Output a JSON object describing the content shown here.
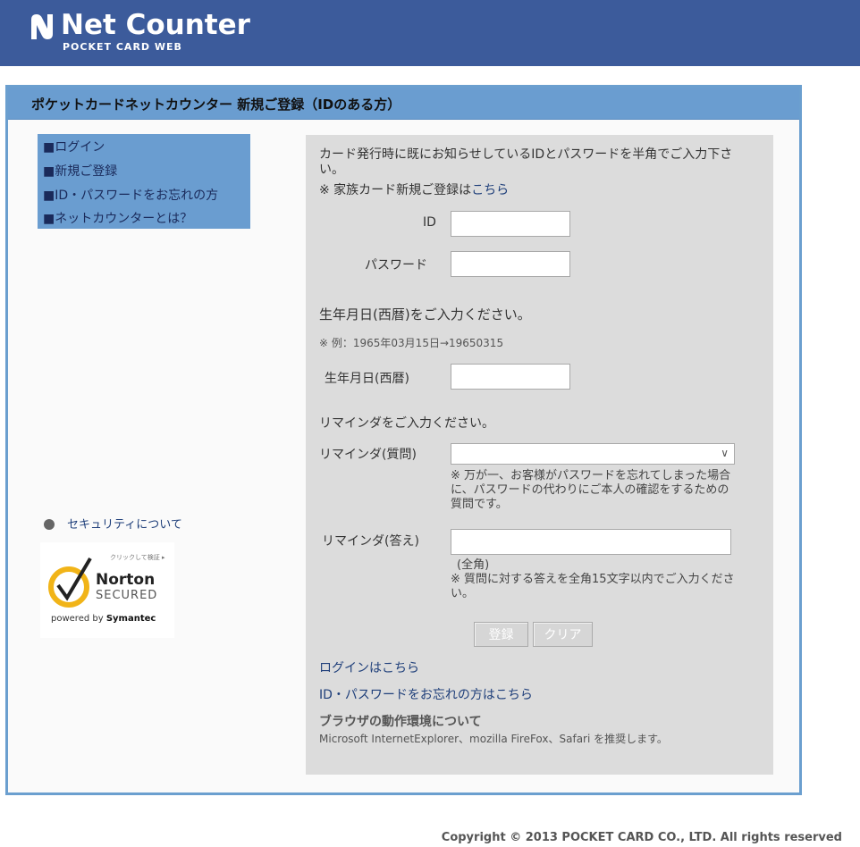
{
  "header": {
    "logo_text": "Net Counter",
    "logo_subtitle": "POCKET CARD WEB"
  },
  "page": {
    "title": "ポケットカードネットカウンター 新規ご登録（IDのある方）"
  },
  "menu": {
    "items": [
      {
        "label": "■ログイン"
      },
      {
        "label": "■新規ご登録"
      },
      {
        "label": "■ID・パスワードをお忘れの方"
      },
      {
        "label": "■ネットカウンターとは？"
      }
    ]
  },
  "security": {
    "link": "セキュリティについて",
    "norton": {
      "click_text": "クリックして検証 ▸",
      "brand": "Norton",
      "secured": "SECURED",
      "powered_prefix": "powered by",
      "powered_by": "Symantec"
    }
  },
  "form": {
    "intro": "カード発行時に既にお知らせしているIDとパスワードを半角でご入力下さい。",
    "family_note_prefix": "※ 家族カード新規ご登録は",
    "family_note_link": "こちら",
    "id_label": "ID",
    "id_value": "",
    "password_label": "パスワード",
    "password_value": "",
    "birth_heading": "生年月日(西暦)をご入力ください。",
    "birth_example": "※ 例：1965年03月15日→19650315",
    "birth_label": "生年月日(西暦)",
    "birth_value": "",
    "reminder_heading": "リマインダをご入力ください。",
    "reminder_question_label": "リマインダ(質問)",
    "reminder_question_selected": "",
    "reminder_question_note": "※ 万が一、お客様がパスワードを忘れてしまった場合に、パスワードの代わりにご本人の確認をするための質問です。",
    "reminder_answer_label": "リマインダ(答え)",
    "reminder_answer_value": "",
    "reminder_answer_hint": "(全角)",
    "reminder_answer_note": "※ 質問に対する答えを全角15文字以内でご入力ください。",
    "register_button": "登録",
    "clear_button": "クリア",
    "login_link": "ログインはこちら",
    "forgot_link": "ID・パスワードをお忘れの方はこちら",
    "env_title": "ブラウザの動作環境について",
    "env_text": "Microsoft InternetExplorer、mozilla FireFox、Safari を推奨します。"
  },
  "footer": {
    "copyright": "Copyright © 2013 POCKET CARD CO., LTD. All rights reserved"
  },
  "colors": {
    "header_bg": "#3c5b9b",
    "titlebar_bg": "#6a9dd0",
    "panel_bg": "#dcdcdc",
    "link": "#1f3f7a"
  }
}
